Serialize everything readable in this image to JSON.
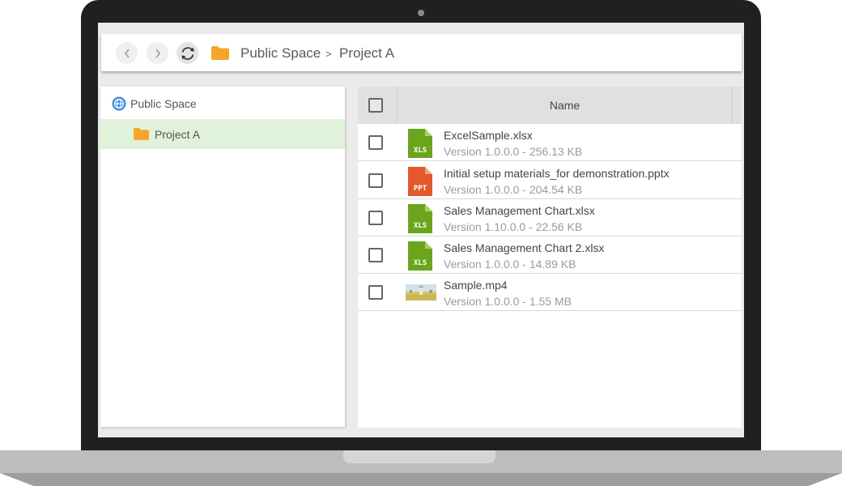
{
  "breadcrumb": {
    "root": "Public Space",
    "separator": ">",
    "current": "Project A"
  },
  "toolbar": {
    "back_icon": "chevron-left-icon",
    "forward_icon": "chevron-right-icon",
    "refresh_icon": "refresh-icon",
    "folder_icon": "folder-icon"
  },
  "sidebar": {
    "root": {
      "label": "Public Space",
      "icon": "globe-icon"
    },
    "children": [
      {
        "label": "Project A",
        "icon": "folder-icon",
        "selected": true
      }
    ]
  },
  "filelist": {
    "header": {
      "name": "Name"
    },
    "rows": [
      {
        "name": "ExcelSample.xlsx",
        "meta": "Version 1.0.0.0 - 256.13 KB",
        "type": "XLS",
        "icon": "excel-file-icon"
      },
      {
        "name": "Initial setup materials_for demonstration.pptx",
        "meta": "Version 1.0.0.0 - 204.54 KB",
        "type": "PPT",
        "icon": "powerpoint-file-icon"
      },
      {
        "name": "Sales Management Chart.xlsx",
        "meta": "Version 1.10.0.0 - 22.56 KB",
        "type": "XLS",
        "icon": "excel-file-icon"
      },
      {
        "name": "Sales Management Chart 2.xlsx",
        "meta": "Version 1.0.0.0 - 14.89 KB",
        "type": "XLS",
        "icon": "excel-file-icon"
      },
      {
        "name": "Sample.mp4",
        "meta": "Version 1.0.0.0 - 1.55 MB",
        "type": "",
        "icon": "video-thumbnail"
      }
    ]
  },
  "colors": {
    "xls": "#6aa51d",
    "ppt": "#e2592b",
    "folder": "#f7a52a",
    "selected_row": "#e1f2da",
    "globe": "#3d8bd6"
  }
}
